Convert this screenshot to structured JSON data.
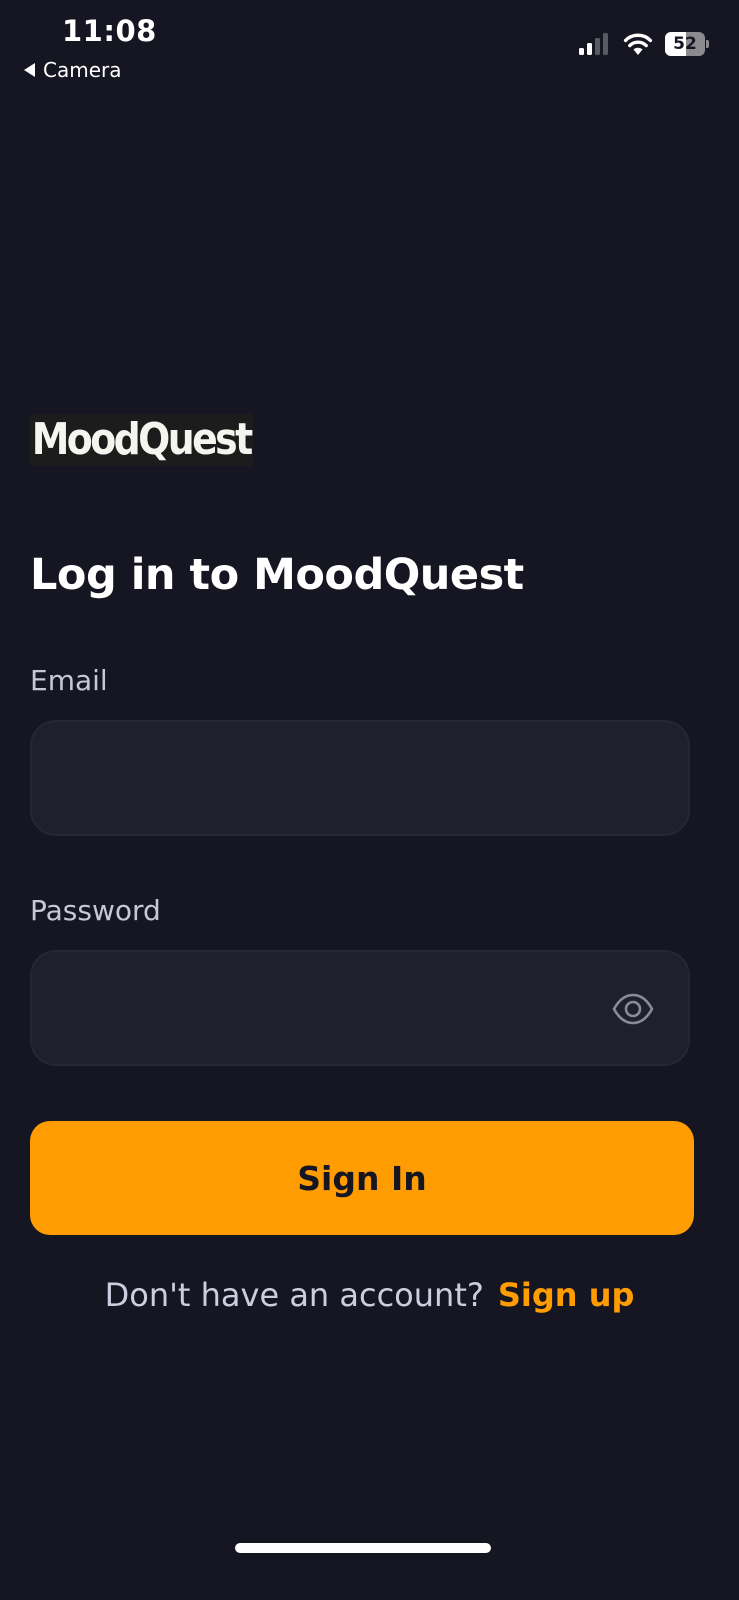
{
  "status_bar": {
    "time": "11:08",
    "back_app": "Camera",
    "battery_level": "52",
    "battery_fraction": 0.52
  },
  "brand": {
    "logo_text": "MoodQuest"
  },
  "login": {
    "title": "Log in to MoodQuest",
    "email_label": "Email",
    "email_value": "",
    "password_label": "Password",
    "password_value": "",
    "submit_label": "Sign In",
    "signup_prompt": "Don't have an account?",
    "signup_link": "Sign up"
  },
  "icons": {
    "back": "back-arrow-icon",
    "signal": "cellular-signal-icon",
    "wifi": "wifi-icon",
    "battery": "battery-icon",
    "password_toggle": "eye-icon"
  },
  "colors": {
    "background": "#161622",
    "input_background": "#1f1f2d",
    "accent": "#ff9c01",
    "label_text": "#c8c8d4"
  }
}
